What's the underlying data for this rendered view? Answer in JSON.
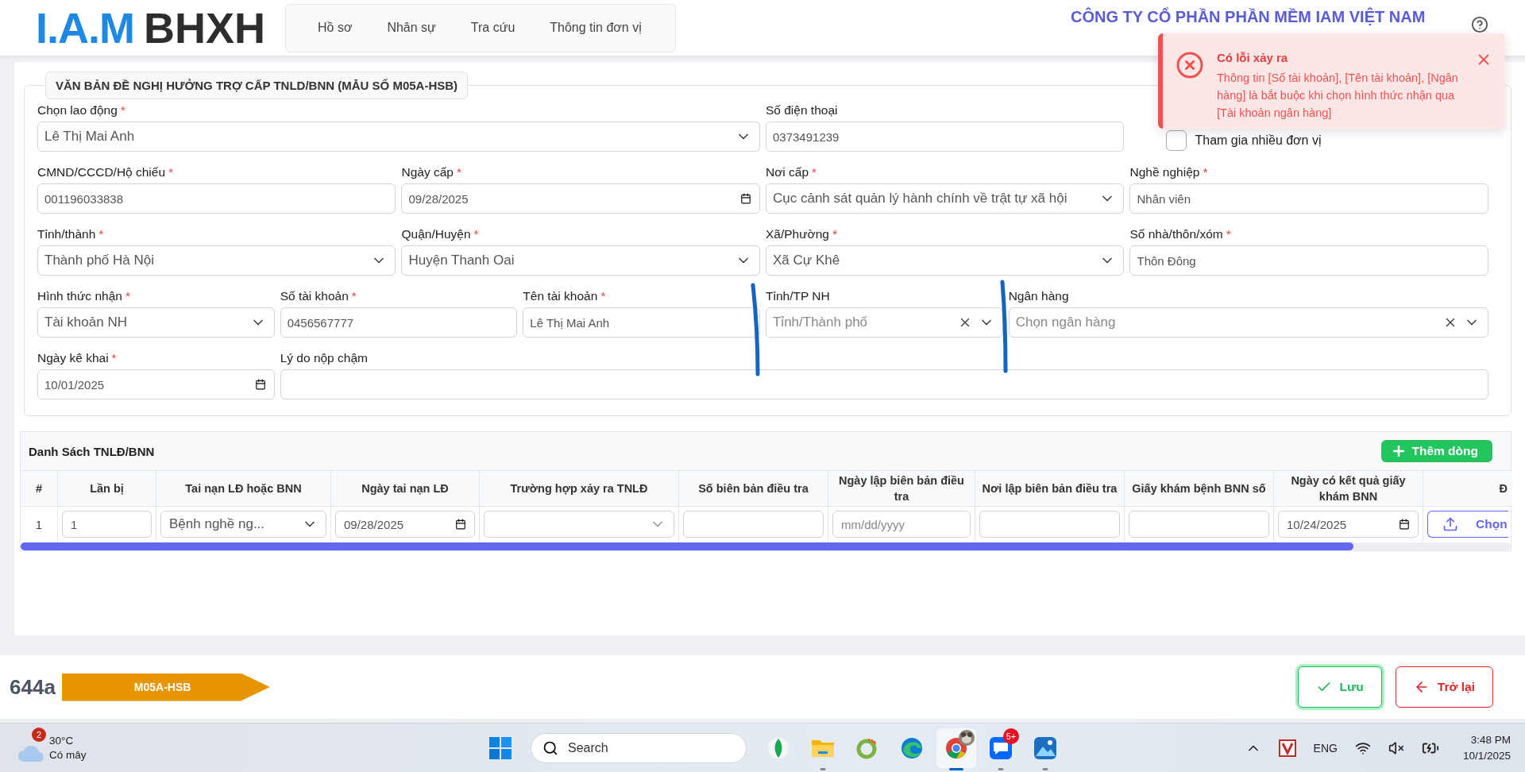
{
  "header": {
    "logo": {
      "mark": "I.A.M",
      "name": "BHXH"
    },
    "nav": [
      {
        "label": "Hồ sơ"
      },
      {
        "label": "Nhân sự"
      },
      {
        "label": "Tra cứu"
      },
      {
        "label": "Thông tin đơn vị"
      }
    ],
    "company": "CÔNG TY CỔ PHẦN PHẦN MỀM IAM VIỆT NAM"
  },
  "toast": {
    "title": "Có lỗi xảy ra",
    "message": "Thông tin [Số tài khoản], [Tên tài khoản], [Ngân hàng] là bắt buộc khi chọn hình thức nhận qua [Tài khoản ngân hàng]"
  },
  "form": {
    "legend": "VĂN BẢN ĐỀ NGHỊ HƯỞNG TRỢ CẤP TNLD/BNN (MẪU SỐ M05A-HSB)",
    "fields": [
      {
        "kind": "select",
        "label": "Chọn lao động",
        "required_mark": "*",
        "value": "Lê Thị Mai Anh"
      },
      {
        "kind": "text",
        "label": "Số điện thoại",
        "value": "0373491239"
      },
      {
        "kind": "checkbox",
        "label": "Tham gia nhiều đơn vị",
        "checked": false
      },
      {
        "kind": "text",
        "label": "CMND/CCCD/Hộ chiếu",
        "required_mark": "*",
        "value": "001196033838"
      },
      {
        "kind": "date",
        "label": "Ngày cấp",
        "required_mark": "*",
        "value": "09/28/2025"
      },
      {
        "kind": "select",
        "label": "Nơi cấp",
        "required_mark": "*",
        "value": "Cục cảnh sát quản lý hành chính về trật tự xã hội"
      },
      {
        "kind": "text",
        "label": "Nghề nghiệp",
        "required_mark": "*",
        "value": "Nhân viên"
      },
      {
        "kind": "select",
        "label": "Tỉnh/thành",
        "required_mark": "*",
        "value": "Thành phố Hà Nội"
      },
      {
        "kind": "select",
        "label": "Quận/Huyện",
        "required_mark": "*",
        "value": "Huyện Thanh Oai"
      },
      {
        "kind": "select",
        "label": "Xã/Phường",
        "required_mark": "*",
        "value": "Xã Cự Khê"
      },
      {
        "kind": "text",
        "label": "Số nhà/thôn/xóm",
        "required_mark": "*",
        "value": "Thôn Đông"
      },
      {
        "kind": "select",
        "label": "Hình thức nhận",
        "required_mark": "*",
        "value": "Tài khoản NH"
      },
      {
        "kind": "text",
        "label": "Số tài khoản",
        "required_mark": "*",
        "value": "0456567777"
      },
      {
        "kind": "text",
        "label": "Tên tài khoản",
        "required_mark": "*",
        "value": "Lê Thị Mai Anh"
      },
      {
        "kind": "search-select",
        "label": "Tỉnh/TP NH",
        "placeholder": "Tỉnh/Thành phố"
      },
      {
        "kind": "search-select",
        "label": "Ngân hàng",
        "placeholder": "Chọn ngân hàng"
      },
      {
        "kind": "date",
        "label": "Ngày kê khai",
        "required_mark": "*",
        "value": "10/01/2025"
      },
      {
        "kind": "text",
        "label": "Lý do nộp chậm"
      }
    ]
  },
  "table": {
    "title": "Danh Sách TNLĐ/BNN",
    "add_button": "Thêm dòng",
    "columns": [
      "#",
      "Lần bị",
      "Tai nạn LĐ hoặc BNN",
      "Ngày tai nạn LĐ",
      "Trường hợp xảy ra TNLĐ",
      "Số biên bản điều tra",
      "Ngày lập biên bản điều tra",
      "Nơi lập biên bản điều tra",
      "Giấy khám bệnh BNN số",
      "Ngày có kết quả giấy khám BNN",
      "Đ"
    ],
    "rows": [
      {
        "cells": [
          {
            "kind": "index",
            "value": "1"
          },
          {
            "kind": "text",
            "value": "1"
          },
          {
            "kind": "select",
            "value": "Bệnh nghề ng..."
          },
          {
            "kind": "date",
            "value": "09/28/2025"
          },
          {
            "kind": "select"
          },
          {
            "kind": "text"
          },
          {
            "kind": "date",
            "placeholder": "mm/dd/yyyy"
          },
          {
            "kind": "text"
          },
          {
            "kind": "text"
          },
          {
            "kind": "date",
            "value": "10/24/2025"
          },
          {
            "kind": "file-button",
            "label": "Chọn"
          }
        ]
      }
    ]
  },
  "footer": {
    "code": "644a",
    "form_tag": "M05A-HSB",
    "buttons": [
      {
        "kind": "save",
        "label": "Lưu",
        "focused": true
      },
      {
        "kind": "back",
        "label": "Trở lại",
        "focused": false
      }
    ]
  },
  "taskbar": {
    "weather": {
      "badge": "2",
      "temperature": "30°C",
      "condition": "Có mây"
    },
    "search": {
      "placeholder": "Search"
    },
    "apps": [
      {
        "kind": "leaf",
        "running": false,
        "selected": false
      },
      {
        "kind": "folder",
        "running": true,
        "selected": false
      },
      {
        "kind": "ring",
        "running": false,
        "selected": false
      },
      {
        "kind": "edge",
        "running": false,
        "selected": false
      },
      {
        "kind": "chrome",
        "running": true,
        "selected": true
      },
      {
        "kind": "chat",
        "running": true,
        "selected": false,
        "badge": "5+"
      },
      {
        "kind": "photos",
        "running": true,
        "selected": false
      }
    ],
    "tray": {
      "language": "ENG",
      "time": "3:48 PM",
      "date": "10/1/2025"
    }
  }
}
